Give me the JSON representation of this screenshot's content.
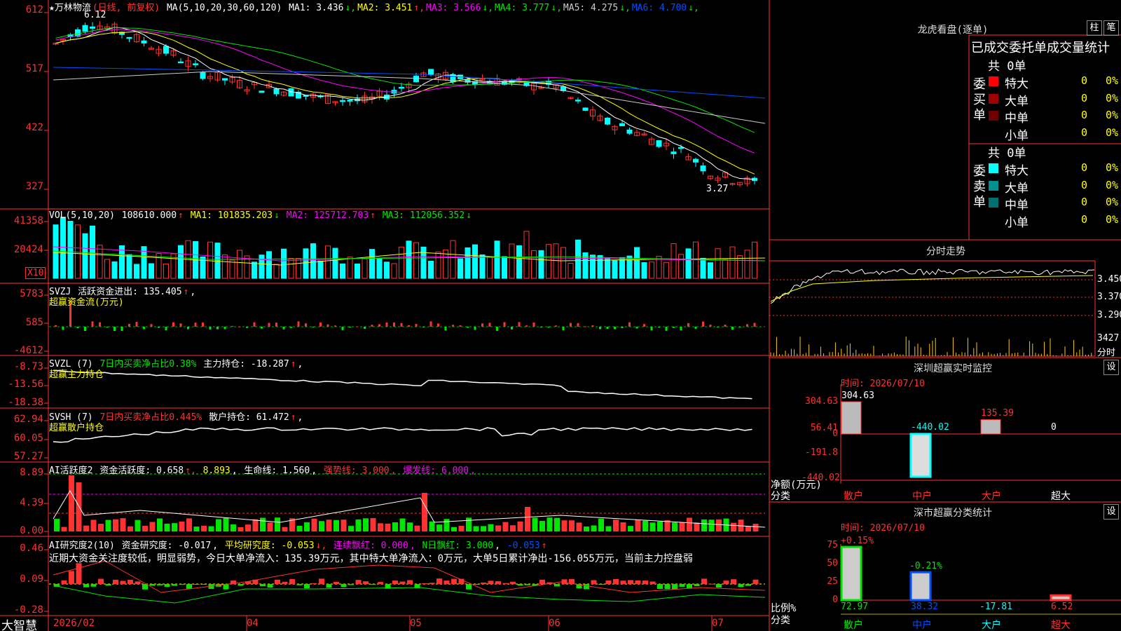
{
  "main": {
    "stock_name": "★万林物流",
    "period": "(日线, 前复权)",
    "ma_label": "MA(5,10,20,30,60,120)",
    "ma": [
      {
        "label": "MA1:",
        "value": "3.436",
        "arrow": "↓",
        "color": "#ffffff"
      },
      {
        "label": "MA2:",
        "value": "3.451",
        "arrow": "↑",
        "color": "#ffff00"
      },
      {
        "label": "MA3:",
        "value": "3.566",
        "arrow": "↓",
        "color": "#ff00ff"
      },
      {
        "label": "MA4:",
        "value": "3.777",
        "arrow": "↓",
        "color": "#00e600"
      },
      {
        "label": "MA5:",
        "value": "4.275",
        "arrow": "↓",
        "color": "#cccccc"
      },
      {
        "label": "MA6:",
        "value": "4.700",
        "arrow": "↓",
        "color": "#0050ff"
      }
    ],
    "y_ticks": [
      "612",
      "517",
      "422",
      "327"
    ],
    "high_mark": "6.12",
    "low_mark": "3.27"
  },
  "vol": {
    "label": "VOL(5,10,20)",
    "value": "108610.000",
    "arrow": "↑",
    "ma1": "MA1: 101835.203",
    "ma1_arrow": "↓",
    "ma2": "MA2: 125712.703",
    "ma2_arrow": "↑",
    "ma3": "MA3: 112056.352",
    "ma3_arrow": "↓",
    "y_ticks": [
      "41358",
      "20424"
    ],
    "unit": "X10"
  },
  "svzj": {
    "label": "SVZJ",
    "text": "活跃资金进出: 135.405",
    "arrow": "↑",
    "sub": "超赢资金流(万元)",
    "y_ticks": [
      "5783",
      "585",
      "-4612"
    ]
  },
  "svzl": {
    "label": "SVZL (7)",
    "text1": "7日内买卖净占比0.38%",
    "text2": "主力持仓: -18.287",
    "arrow": "↑",
    "sub": "超赢主力持仓",
    "y_ticks": [
      "-8.73",
      "-13.56",
      "-18.38"
    ]
  },
  "svsh": {
    "label": "SVSH (7)",
    "text1": "7日内买卖净占比0.445%",
    "text2": "散户持仓: 61.472",
    "arrow": "↑",
    "sub": "超赢散户持仓",
    "y_ticks": [
      "62.94",
      "60.05",
      "57.27"
    ]
  },
  "ai1": {
    "label": "AI活跃度2",
    "t1": "资金活跃度: 0.658",
    "t2": "8.893",
    "t3": "生命线: 1.560",
    "t4": "强势线: 3.000",
    "t5": "爆发线: 6.000",
    "y_ticks": [
      "8.89",
      "4.39",
      "0.00"
    ]
  },
  "ai2": {
    "label": "AI研究度2(10)",
    "t1": "资金研究度: -0.017",
    "t2": "平均研究度: -0.053",
    "t3": "连续飘红: 0.000",
    "t4": "N日飘红: 3.000",
    "t5": "-0.053",
    "note": "近期大资金关注度较低，明显弱势，今日大单净流入：135.39万元，其中特大单净流入：0万元，大单5日累计净出-156.055万元，当前主力控盘弱",
    "y_ticks": [
      "0.46",
      "0.09",
      "-0.28"
    ]
  },
  "bottom": {
    "brand": "大智慧",
    "dates": [
      "2026/02",
      "04",
      "05",
      "06",
      "07"
    ]
  },
  "right": {
    "lhb_title": "龙虎看盘(逐单)",
    "btn_zhu": "柱",
    "btn_bi": "笔",
    "tabs": "已成交委托单成交量统计",
    "buy": {
      "side_label": "委买单",
      "total": "共 0单",
      "rows": [
        {
          "name": "特大",
          "count": "0",
          "pct": "0%",
          "color": "#ff0000"
        },
        {
          "name": "大单",
          "count": "0",
          "pct": "0%",
          "color": "#a00000"
        },
        {
          "name": "中单",
          "count": "0",
          "pct": "0%",
          "color": "#700000"
        },
        {
          "name": "小单",
          "count": "0",
          "pct": "0%",
          "color": ""
        }
      ]
    },
    "sell": {
      "side_label": "委卖单",
      "total": "共 0单",
      "rows": [
        {
          "name": "特大",
          "count": "0",
          "pct": "0%",
          "color": "#00ffff"
        },
        {
          "name": "大单",
          "count": "0",
          "pct": "0%",
          "color": "#009090"
        },
        {
          "name": "中单",
          "count": "0",
          "pct": "0%",
          "color": "#007070"
        },
        {
          "name": "小单",
          "count": "0",
          "pct": "0%",
          "color": ""
        }
      ]
    },
    "intraday": {
      "title": "分时走势",
      "y_ticks": [
        "3.450",
        "3.370",
        "3.290"
      ],
      "vol_tick": "3427",
      "vol_label": "分时"
    },
    "sz_monitor": {
      "title": "深圳超赢实时监控",
      "btn": "设",
      "time": "时间: 2026/07/10",
      "y_ticks": [
        "304.63",
        "56.41",
        "0",
        "-191.8",
        "-440.02"
      ],
      "y_label": "净额(万元)",
      "x_label": "分类",
      "categories": [
        "散户",
        "中户",
        "大户",
        "超大"
      ],
      "values": [
        "304.63",
        "-440.02",
        "135.39",
        "0"
      ]
    },
    "sz_class": {
      "title": "深市超赢分类统计",
      "btn": "设",
      "time": "时间: 2026/07/10",
      "y_ticks": [
        "75",
        "50",
        "25",
        "0"
      ],
      "y_label": "比例%",
      "x_label": "分类",
      "categories": [
        "散户",
        "中户",
        "大户",
        "超大"
      ],
      "values": [
        "72.97",
        "38.32",
        "-17.81",
        "6.52"
      ],
      "changes": [
        "+0.15%",
        "-0.21%",
        "",
        ""
      ]
    }
  },
  "chart_data": {
    "type": "candlestick",
    "ylim": [
      3.27,
      6.12
    ],
    "note": "daily candles 2026/02 - 2026/07, close trend from ~5.6 down to ~3.3"
  }
}
